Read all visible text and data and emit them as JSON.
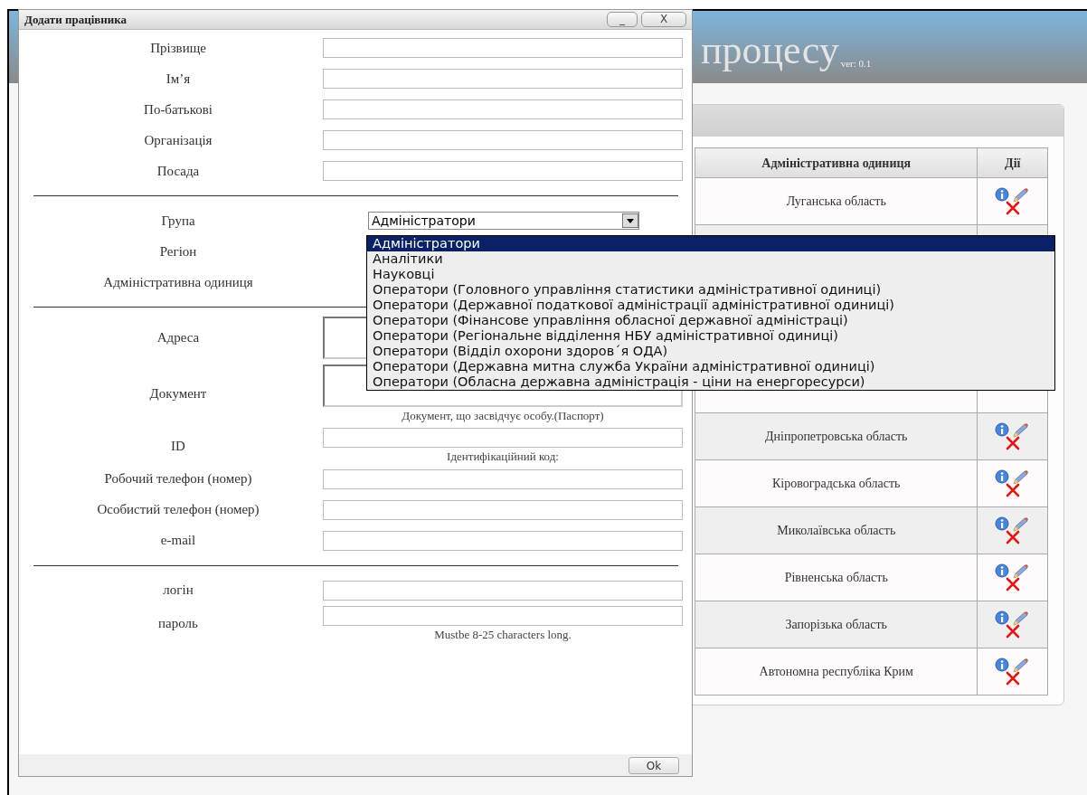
{
  "background": {
    "title": "процесу",
    "version": "ver: 0.1",
    "table": {
      "columns": [
        "Адміністративна одиниця",
        "Дії"
      ],
      "rows": [
        {
          "region": "Луганська область"
        },
        {},
        {},
        {},
        {},
        {
          "region": "Дніпропетровська область"
        },
        {
          "region": "Кіровоградська область"
        },
        {
          "region": "Миколаївська область"
        },
        {
          "region": "Рівненська область"
        },
        {
          "region": "Запорізька область"
        },
        {
          "region": "Автономна республіка Крим"
        }
      ]
    }
  },
  "dialog": {
    "title": "Додати працівника",
    "minimize_button": "_",
    "close_button": "X",
    "fields": [
      {
        "kind": "input",
        "label": "Прізвище"
      },
      {
        "kind": "input",
        "label": "Ім’я"
      },
      {
        "kind": "input",
        "label": "По-батькові"
      },
      {
        "kind": "input",
        "label": "Організація"
      },
      {
        "kind": "input",
        "label": "Посада"
      },
      {
        "kind": "separator"
      },
      {
        "kind": "select",
        "label": "Група",
        "value": "Адміністратори"
      },
      {
        "kind": "covered",
        "label": "Регіон"
      },
      {
        "kind": "covered",
        "label": "Адміністративна одиниця"
      },
      {
        "kind": "separator"
      },
      {
        "kind": "textarea",
        "label": "Адреса"
      },
      {
        "kind": "textarea",
        "label": "Документ",
        "hint": "Документ, що засвідчує особу.(Паспорт)"
      },
      {
        "kind": "input",
        "label": "ID",
        "hint": "Ідентифікаційний код:"
      },
      {
        "kind": "input",
        "label": "Робочий телефон (номер)"
      },
      {
        "kind": "input",
        "label": "Особистий телефон (номер)"
      },
      {
        "kind": "input",
        "label": "e-mail"
      },
      {
        "kind": "separator"
      },
      {
        "kind": "input",
        "label": "логін"
      },
      {
        "kind": "password",
        "label": "пароль",
        "hint": "Mustbe 8-25 characters long."
      }
    ],
    "ok_button": "Ok"
  },
  "dropdown": {
    "options": [
      {
        "label": "Адміністратори",
        "selected": true
      },
      {
        "label": "Аналітики",
        "selected": false
      },
      {
        "label": "Науковці",
        "selected": false
      },
      {
        "label": "Оператори (Головного управління статистики адміністративної одиниці)",
        "selected": false
      },
      {
        "label": "Оператори (Державної податкової адміністрації адміністративної одиниці)",
        "selected": false
      },
      {
        "label": "Оператори (Фінансове управління обласної державної адміністраці)",
        "selected": false
      },
      {
        "label": "Оператори (Регіональне відділення НБУ адміністративної одиниці)",
        "selected": false
      },
      {
        "label": "Оператори (Відділ охорони здоров´я ОДА)",
        "selected": false
      },
      {
        "label": "Оператори (Державна митна служба України адміністративної одиниці)",
        "selected": false
      },
      {
        "label": "Оператори (Обласна державна адміністрація - ціни на енергоресурси)",
        "selected": false
      }
    ]
  }
}
